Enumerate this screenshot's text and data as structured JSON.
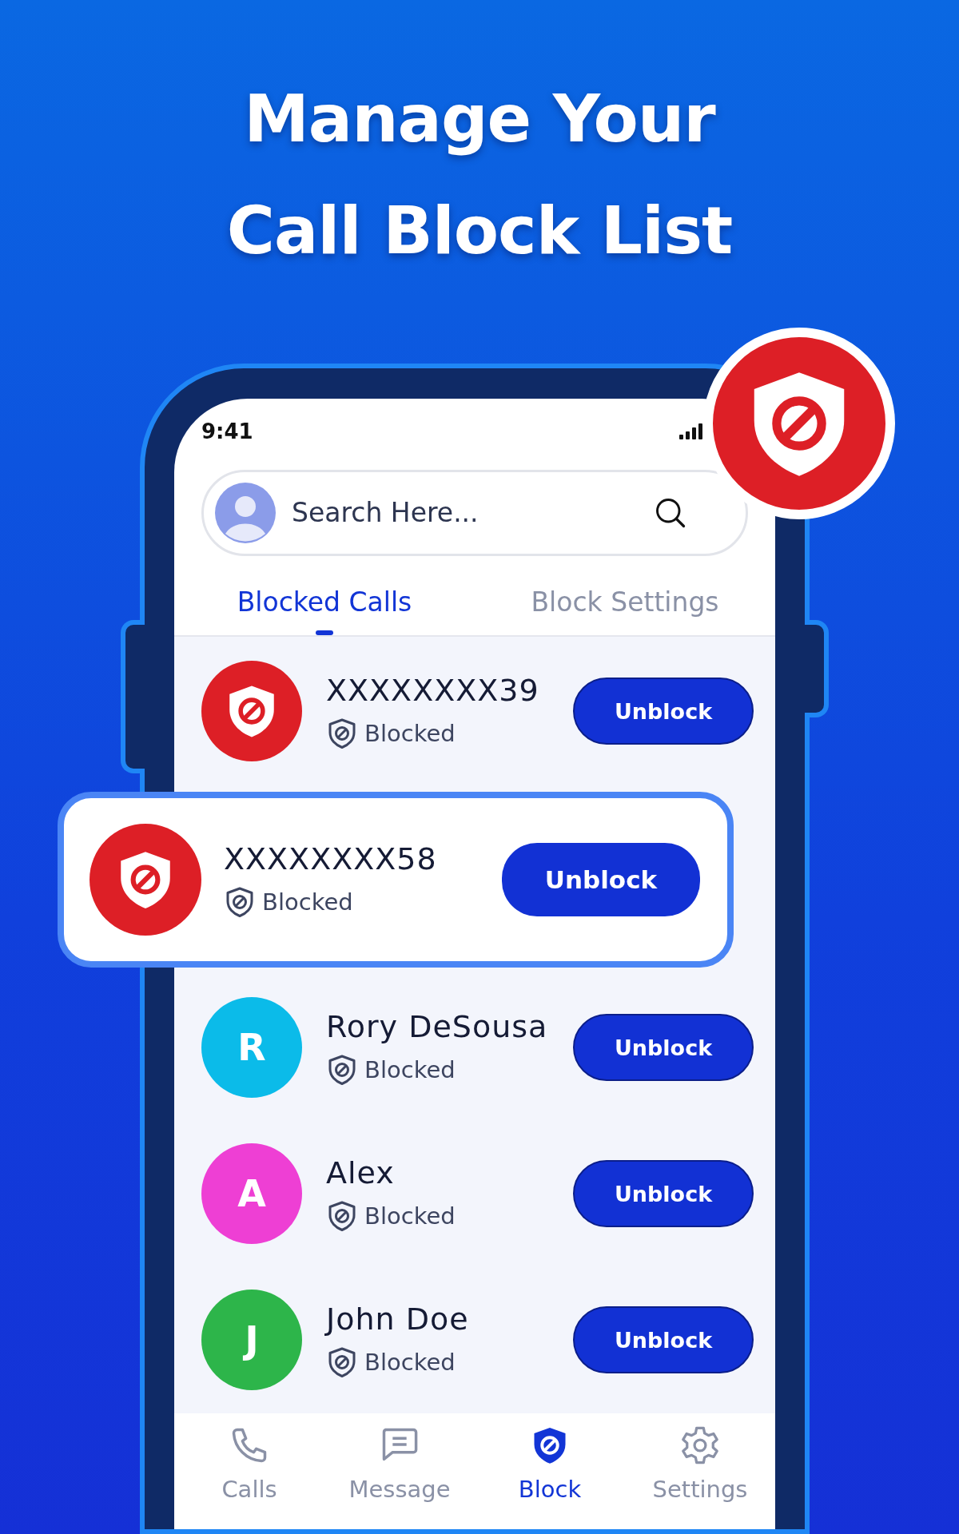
{
  "headline": [
    "Manage Your",
    "Call Block List"
  ],
  "status_bar": {
    "time": "9:41"
  },
  "search": {
    "placeholder": "Search Here..."
  },
  "tabs": [
    {
      "label": "Blocked Calls",
      "selected": true
    },
    {
      "label": "Block Settings",
      "selected": false
    }
  ],
  "contacts": [
    {
      "kind": "blocked",
      "name": "XXXXXXXX39",
      "status": "Blocked",
      "button": "Unblock",
      "highlighted": false
    },
    {
      "kind": "blocked",
      "name": "XXXXXXXX58",
      "status": "Blocked",
      "button": "Unblock",
      "highlighted": true
    },
    {
      "kind": "letter",
      "initial": "R",
      "color": "#0bbbe9",
      "name": "Rory DeSousa",
      "status": "Blocked",
      "button": "Unblock",
      "highlighted": false
    },
    {
      "kind": "letter",
      "initial": "A",
      "color": "#ee3fd4",
      "name": "Alex",
      "status": "Blocked",
      "button": "Unblock",
      "highlighted": false
    },
    {
      "kind": "letter",
      "initial": "J",
      "color": "#2db54a",
      "name": "John Doe",
      "status": "Blocked",
      "button": "Unblock",
      "highlighted": false
    }
  ],
  "bottom_nav": [
    {
      "label": "Calls",
      "selected": false
    },
    {
      "label": "Message",
      "selected": false
    },
    {
      "label": "Block",
      "selected": true
    },
    {
      "label": "Settings",
      "selected": false
    }
  ]
}
